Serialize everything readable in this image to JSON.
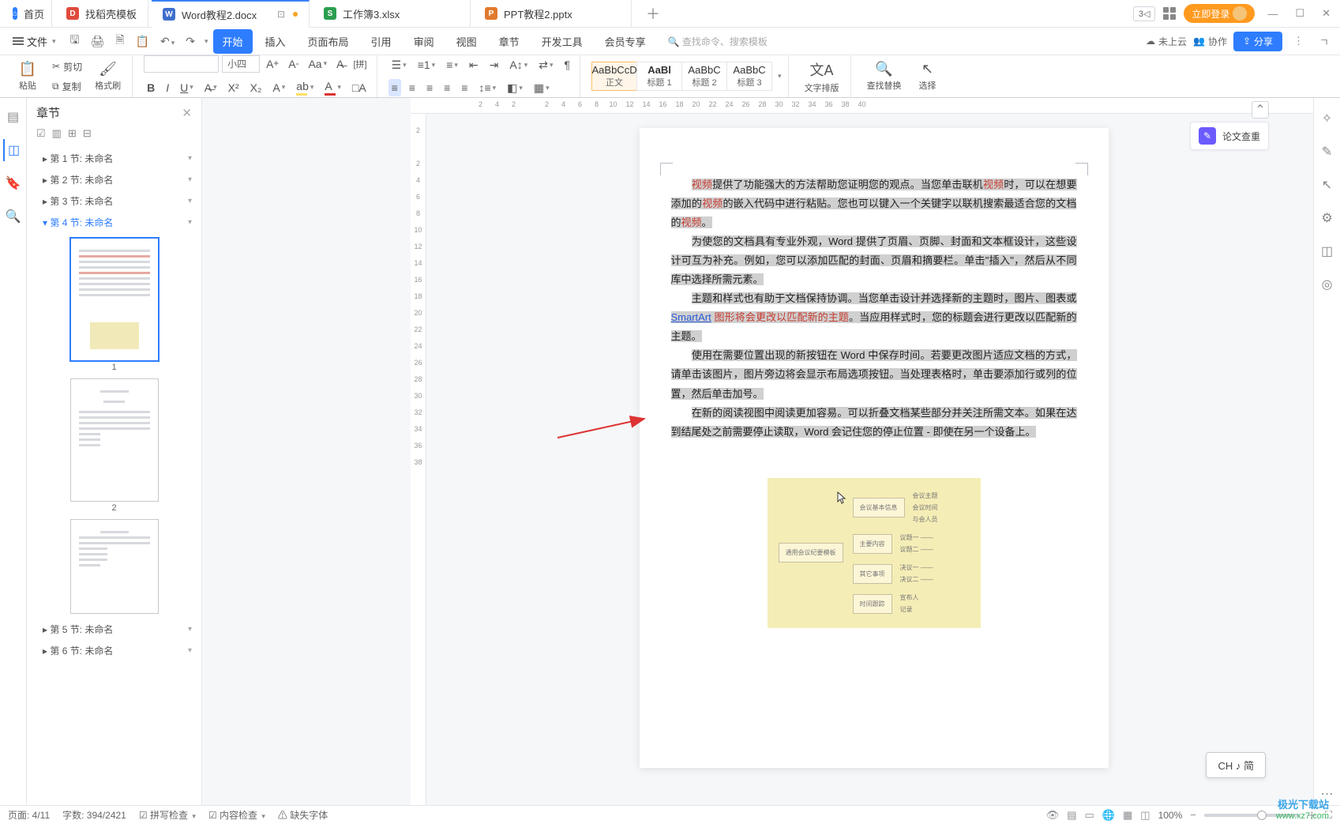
{
  "tabs": {
    "home": "首页",
    "dg": "找稻壳模板",
    "active": "Word教程2.docx",
    "xls": "工作簿3.xlsx",
    "ppt": "PPT教程2.pptx"
  },
  "title_right": {
    "indicator": "3",
    "login": "立即登录"
  },
  "menubar": {
    "file": "文件",
    "tabs": [
      "开始",
      "插入",
      "页面布局",
      "引用",
      "审阅",
      "视图",
      "章节",
      "开发工具",
      "会员专享"
    ],
    "active_tab_index": 0,
    "search_placeholder": "查找命令、搜索模板",
    "cloud": "未上云",
    "collab": "协作",
    "share": "分享"
  },
  "ribbon": {
    "paste": "粘贴",
    "cut": "剪切",
    "copy": "复制",
    "format_painter": "格式刷",
    "font_name": "",
    "font_size": "小四",
    "styles": [
      {
        "preview": "AaBbCcD",
        "label": "正文"
      },
      {
        "preview": "AaBl",
        "label": "标题 1"
      },
      {
        "preview": "AaBbC",
        "label": "标题 2"
      },
      {
        "preview": "AaBbC",
        "label": "标题 3"
      }
    ],
    "layout": "文字排版",
    "find_replace": "查找替换",
    "select": "选择"
  },
  "nav": {
    "title": "章节",
    "items": [
      "第 1 节: 未命名",
      "第 2 节: 未命名",
      "第 3 节: 未命名",
      "第 4 节: 未命名",
      "第 5 节: 未命名",
      "第 6 节: 未命名"
    ],
    "selected_index": 3,
    "thumb_nums": [
      "1",
      "2",
      ""
    ]
  },
  "h_ruler": [
    "2",
    "4",
    "2",
    "",
    "2",
    "4",
    "6",
    "8",
    "10",
    "12",
    "14",
    "16",
    "18",
    "20",
    "22",
    "24",
    "26",
    "28",
    "30",
    "32",
    "34",
    "36",
    "38",
    "40"
  ],
  "v_ruler": [
    "2",
    "",
    "2",
    "4",
    "6",
    "8",
    "10",
    "12",
    "14",
    "16",
    "18",
    "20",
    "22",
    "24",
    "26",
    "28",
    "30",
    "32",
    "34",
    "36",
    "38"
  ],
  "document": {
    "p1_a": "视频",
    "p1_b": "提供了功能强大的方法帮助您证明您的观点。当您单击联机",
    "p1_c": "视频",
    "p1_d": "时，可以在想要添加的",
    "p1_e": "视频",
    "p1_f": "的嵌入代码中进行粘贴。您也可以键入一个关键字以联机搜索最适合您的文档的",
    "p1_g": "视频",
    "p1_h": "。",
    "p2": "为使您的文档具有专业外观，Word 提供了页眉、页脚、封面和文本框设计，这些设计可互为补充。例如，您可以添加匹配的封面、页眉和摘要栏。单击\"插入\"，然后从不同库中选择所需元素。",
    "p3_a": "主题和样式也有助于文档保持协调。当您单击设计并选择新的主题时，图片、图表或 ",
    "p3_b": "SmartArt",
    "p3_c": " 图形将会更改以匹配新的主题",
    "p3_d": "。当应用样式时，您的标题会进行更改以匹配新的主题。",
    "p4": "使用在需要位置出现的新按钮在 Word 中保存时间。若要更改图片适应文档的方式，请单击该图片，图片旁边将会显示布局选项按钮。当处理表格时，单击要添加行或列的位置，然后单击加号。",
    "p5": "在新的阅读视图中阅读更加容易。可以折叠文档某些部分并关注所需文本。如果在达到结尾处之前需要停止读取，Word 会记住您的停止位置 - 即使在另一个设备上。",
    "diagram_root": "通用会议纪要模板",
    "diagram_b1": "会议基本信息",
    "diagram_b2": "主要内容",
    "diagram_b3": "其它事项",
    "diagram_b4": "时间跟踪",
    "diagram_leaf": [
      "会议主题",
      "会议时间",
      "与会人员",
      "议题一 ——",
      "议题二 ——",
      "决议一 ——",
      "决议二 ——",
      "宣布人",
      "记录"
    ]
  },
  "right_panel": {
    "paper_check": "论文查重"
  },
  "ime": "CH ♪ 简",
  "status": {
    "page": "页面: 4/11",
    "words": "字数: 394/2421",
    "spell": "拼写检查",
    "content": "内容检查",
    "missing_font": "缺失字体",
    "zoom": "100%"
  },
  "watermark": {
    "a": "极光下载站",
    "b": "www.xz7.com"
  }
}
